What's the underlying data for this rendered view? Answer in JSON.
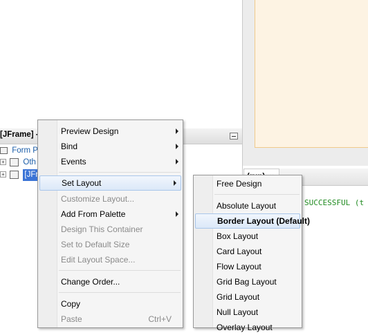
{
  "navigator": {
    "title": "[JFrame] -",
    "tree": [
      {
        "label": "Form Pr"
      },
      {
        "label": "Oth"
      },
      {
        "label": "[JFr"
      }
    ]
  },
  "output": {
    "tab_label": "(run)",
    "close_glyph": "✖",
    "text": "SUCCESSFUL (t"
  },
  "context_menu": {
    "items": [
      {
        "label": "Preview Design",
        "submenu": true,
        "enabled": true
      },
      {
        "label": "Bind",
        "submenu": true,
        "enabled": true
      },
      {
        "label": "Events",
        "submenu": true,
        "enabled": true
      },
      {
        "label": "Set Layout",
        "submenu": true,
        "enabled": true,
        "highlighted": true
      },
      {
        "label": "Customize Layout...",
        "enabled": false
      },
      {
        "label": "Add From Palette",
        "submenu": true,
        "enabled": true
      },
      {
        "label": "Design This Container",
        "enabled": false
      },
      {
        "label": "Set to Default Size",
        "enabled": false
      },
      {
        "label": "Edit Layout Space...",
        "enabled": false
      },
      {
        "label": "Change Order...",
        "enabled": true
      },
      {
        "label": "Copy",
        "enabled": true
      },
      {
        "label": "Paste",
        "enabled": false,
        "shortcut": "Ctrl+V"
      }
    ]
  },
  "layout_submenu": {
    "items": [
      {
        "label": "Free Design"
      },
      {
        "label": "Absolute Layout"
      },
      {
        "label": "Border Layout (Default)",
        "highlighted": true,
        "bold": true
      },
      {
        "label": "Box Layout"
      },
      {
        "label": "Card Layout"
      },
      {
        "label": "Flow Layout"
      },
      {
        "label": "Grid Bag Layout"
      },
      {
        "label": "Grid Layout"
      },
      {
        "label": "Null Layout"
      },
      {
        "label": "Overlay Layout"
      }
    ]
  }
}
